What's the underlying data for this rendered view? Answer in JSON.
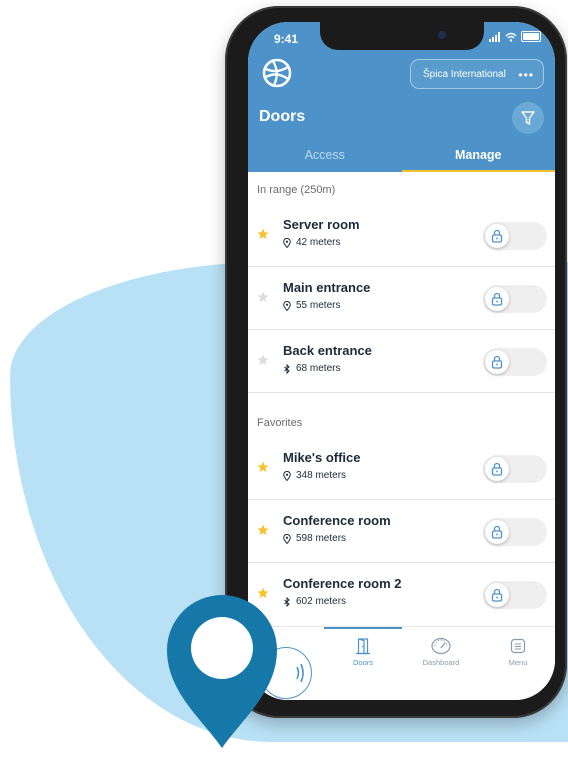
{
  "status_bar": {
    "time": "9:41"
  },
  "header": {
    "org_name": "Špica International",
    "more_icon": "more-horizontal-icon",
    "title": "Doors",
    "filter_icon": "filter-icon",
    "logo_icon": "globe-logo-icon"
  },
  "tabs": [
    {
      "label": "Access",
      "active": false
    },
    {
      "label": "Manage",
      "active": true
    }
  ],
  "sections": [
    {
      "label": "In range (250m)",
      "items": [
        {
          "name": "Server room",
          "distance": "42 meters",
          "favorite": true,
          "proximity": "location"
        },
        {
          "name": "Main entrance",
          "distance": "55 meters",
          "favorite": false,
          "proximity": "location"
        },
        {
          "name": "Back entrance",
          "distance": "68 meters",
          "favorite": false,
          "proximity": "bluetooth"
        }
      ]
    },
    {
      "label": "Favorites",
      "items": [
        {
          "name": "Mike's office",
          "distance": "348 meters",
          "favorite": true,
          "proximity": "location"
        },
        {
          "name": "Conference room",
          "distance": "598 meters",
          "favorite": true,
          "proximity": "location"
        },
        {
          "name": "Conference room 2",
          "distance": "602 meters",
          "favorite": true,
          "proximity": "bluetooth"
        }
      ]
    }
  ],
  "bottom_nav": [
    {
      "label": "Doors",
      "icon": "door-icon",
      "active": true
    },
    {
      "label": "Dashboard",
      "icon": "dashboard-gauge-icon",
      "active": false
    },
    {
      "label": "Menu",
      "icon": "menu-icon",
      "active": false
    }
  ],
  "colors": {
    "header_blue": "#4d93c9",
    "accent_yellow": "#f4c430",
    "background_blob": "#b9e1f5",
    "pin_blue": "#1677a9"
  }
}
